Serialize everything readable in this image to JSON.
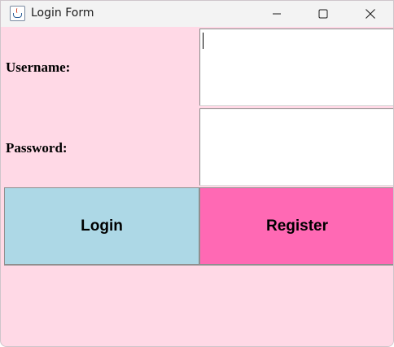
{
  "window": {
    "title": "Login Form",
    "icon": "java-cup-icon"
  },
  "controls": {
    "minimize": "minimize-icon",
    "maximize": "maximize-icon",
    "close": "close-icon"
  },
  "form": {
    "username_label": "Username:",
    "password_label": "Password:",
    "username_value": "",
    "password_value": ""
  },
  "buttons": {
    "login_label": "Login",
    "register_label": "Register"
  },
  "colors": {
    "background": "#ffd9e6",
    "login": "#add8e6",
    "register": "#ff69b4"
  }
}
